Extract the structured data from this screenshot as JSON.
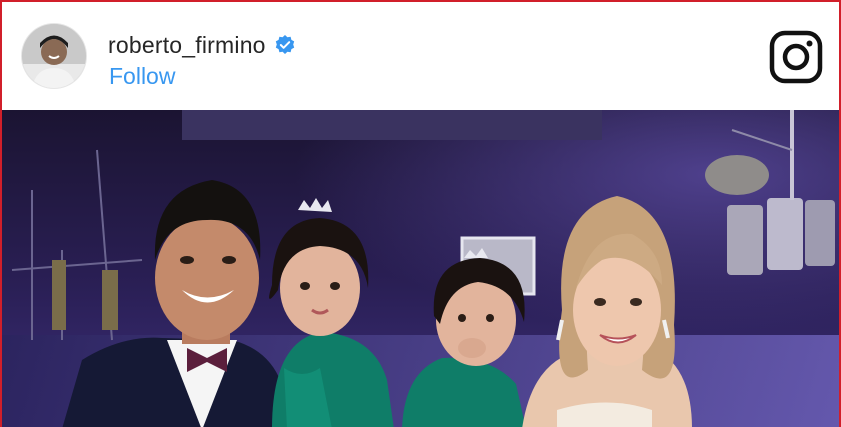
{
  "post_header": {
    "username": "roberto_firmino",
    "verified_icon": "verified-badge-icon",
    "follow_label": "Follow",
    "brand_icon": "instagram-icon"
  },
  "colors": {
    "border": "#d11f2a",
    "follow": "#3897f0",
    "username": "#262626",
    "verified": "#3897f0"
  },
  "photo": {
    "subject_icon": "family-photo"
  }
}
